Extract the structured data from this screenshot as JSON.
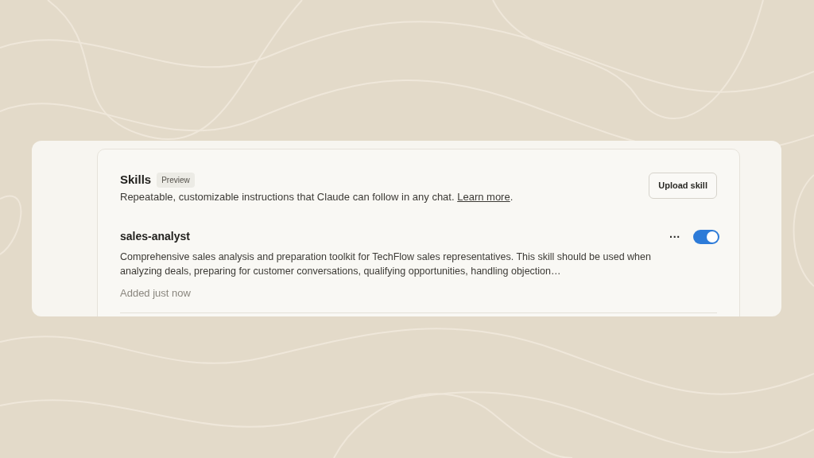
{
  "header": {
    "title": "Skills",
    "badge": "Preview",
    "button": "Upload skill",
    "description": "Repeatable, customizable instructions that Claude can follow in any chat.",
    "link": "Learn more",
    "after_link": "."
  },
  "skills": [
    {
      "name": "sales-analyst",
      "description": "Comprehensive sales analysis and preparation toolkit for TechFlow sales representatives. This skill should be used when analyzing deals, preparing for customer conversations, qualifying opportunities, handling objection…",
      "meta": "Added just now",
      "menu": "···",
      "enabled": true
    }
  ]
}
